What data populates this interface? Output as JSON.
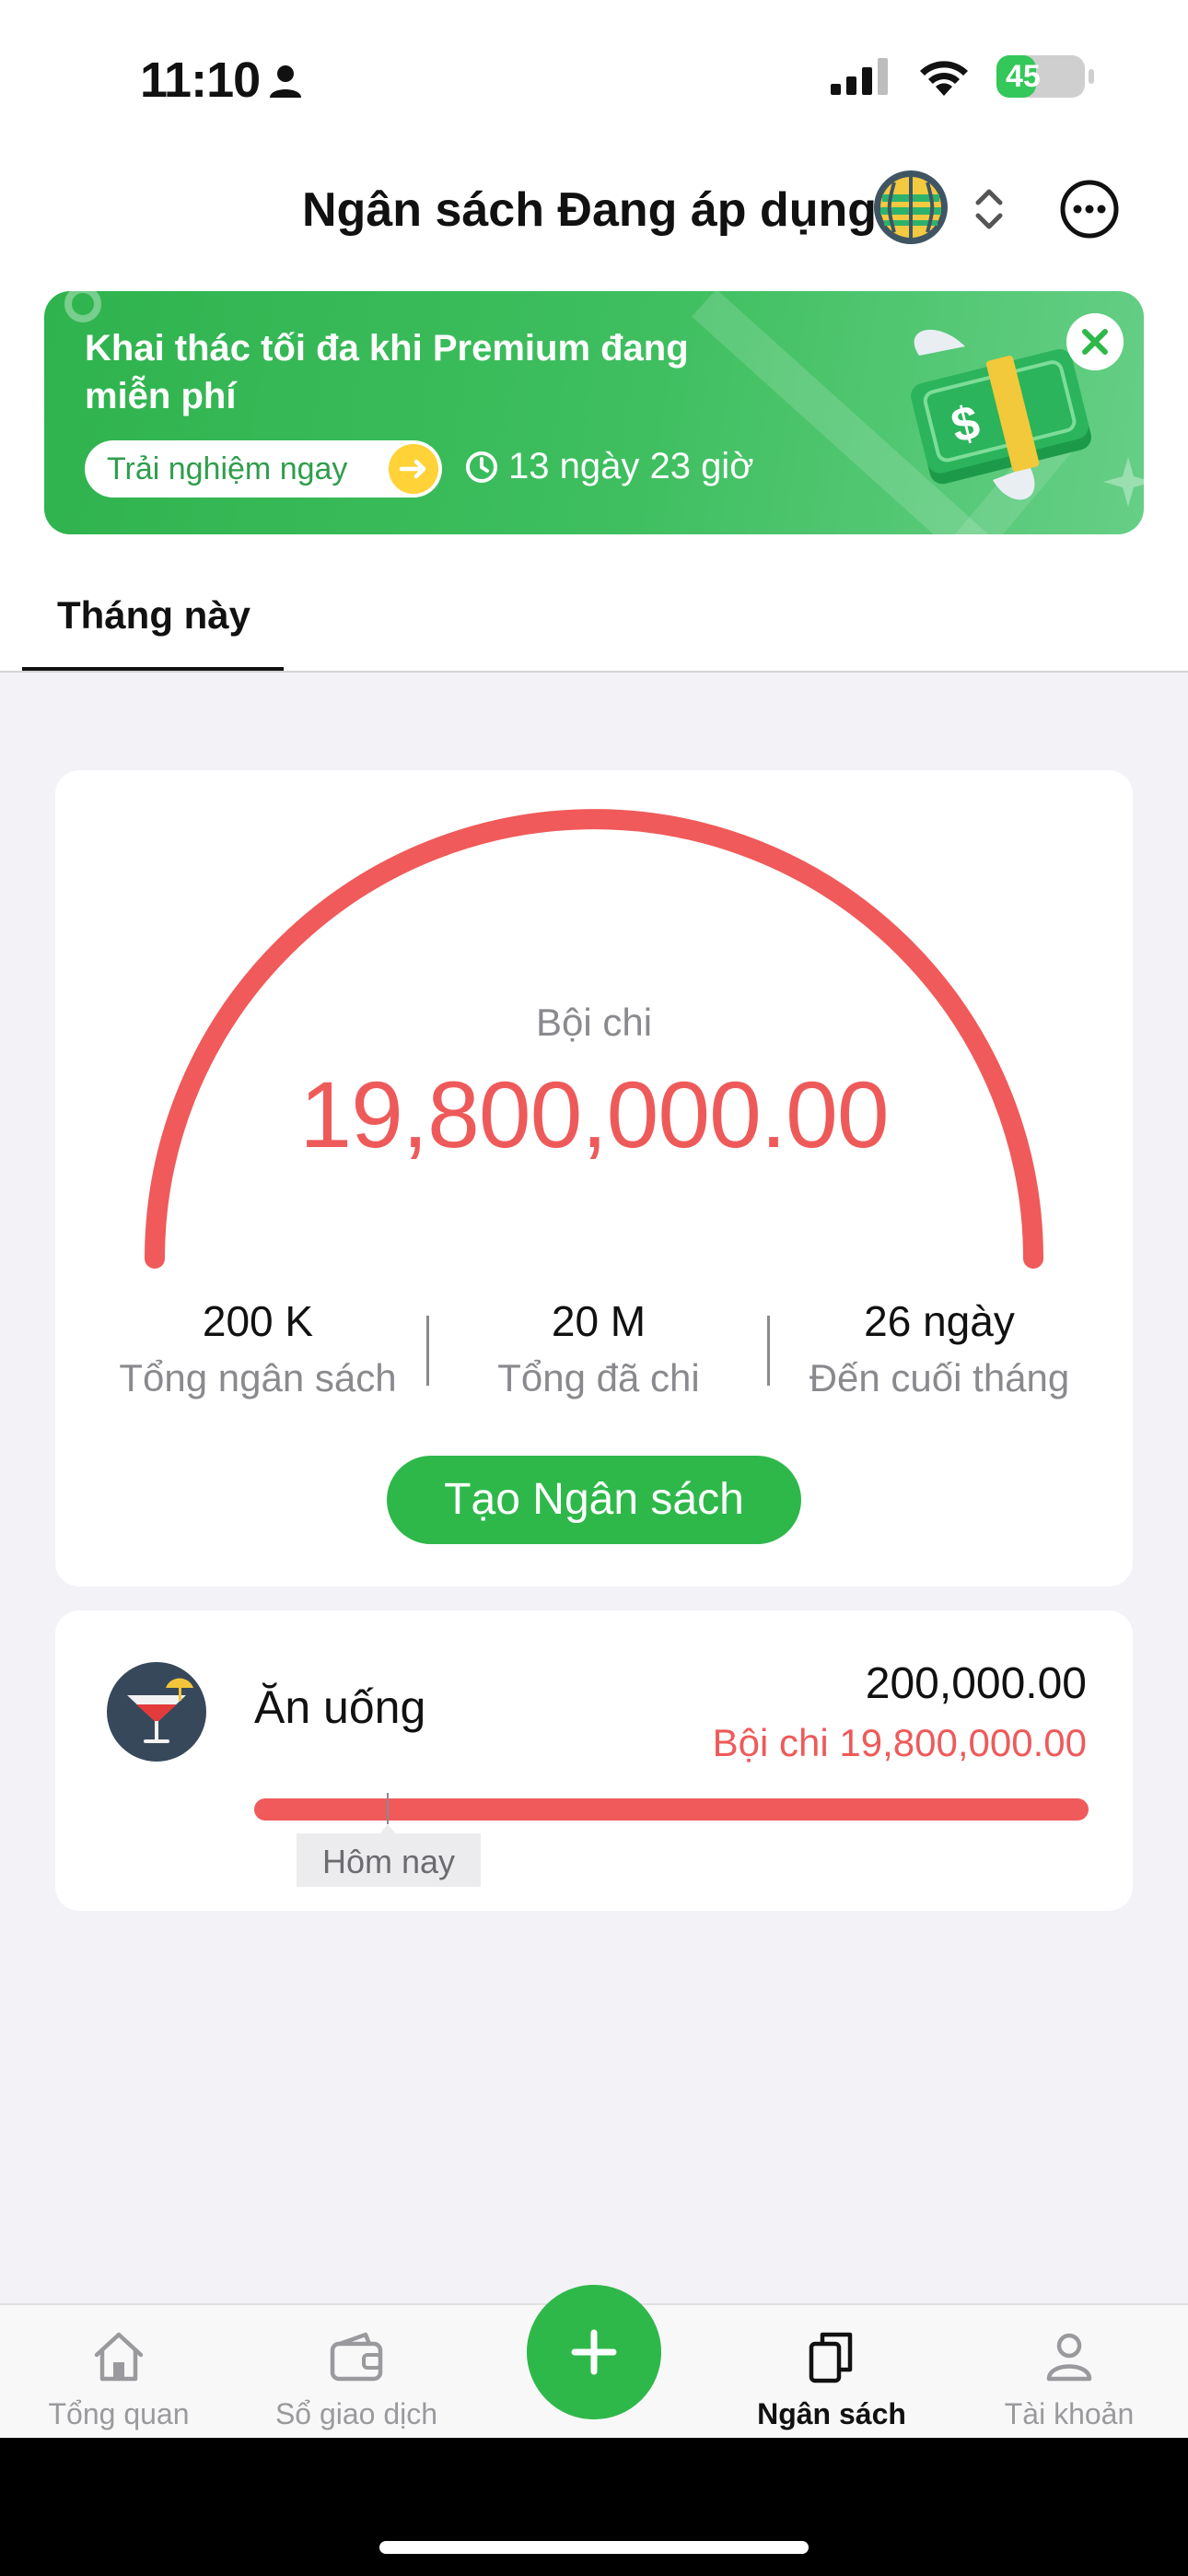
{
  "status_bar": {
    "time": "11:10",
    "battery_level": "45",
    "battery_fraction": 0.45
  },
  "header": {
    "title": "Ngân sách Đang áp dụng"
  },
  "promo": {
    "title": "Khai thác tối đa khi Premium đang miễn phí",
    "cta_label": "Trải nghiệm ngay",
    "countdown": "13 ngày 23 giờ"
  },
  "tabs": [
    {
      "label": "Tháng này",
      "active": true
    }
  ],
  "summary": {
    "gauge_caption": "Bội chi",
    "gauge_value": "19,800,000.00",
    "stats": [
      {
        "value": "200 K",
        "label": "Tổng ngân sách"
      },
      {
        "value": "20 M",
        "label": "Tổng đã chi"
      },
      {
        "value": "26 ngày",
        "label": "Đến cuối tháng"
      }
    ],
    "create_button": "Tạo Ngân sách"
  },
  "budget_items": [
    {
      "icon": "cocktail-icon",
      "name": "Ăn uống",
      "amount": "200,000.00",
      "status": "Bội chi 19,800,000.00",
      "today_label": "Hôm nay"
    }
  ],
  "bottom_nav": [
    {
      "label": "Tổng quan",
      "icon": "home-icon"
    },
    {
      "label": "Sổ giao dịch",
      "icon": "wallet-icon"
    },
    {
      "label": "Ngân sách",
      "icon": "budget-icon",
      "active": true
    },
    {
      "label": "Tài khoản",
      "icon": "person-icon"
    }
  ],
  "colors": {
    "accent_green": "#2fb84a",
    "over_budget_red": "#ee5a5a",
    "highlight_yellow": "#ffd338"
  }
}
